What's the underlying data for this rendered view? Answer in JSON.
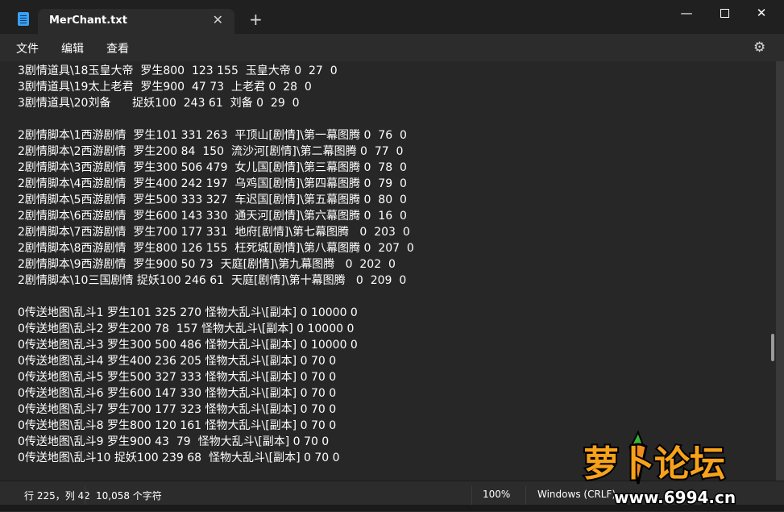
{
  "window": {
    "tab_title": "MerChant.txt",
    "tab_close": "✕",
    "new_tab": "+",
    "minimize": "—",
    "close": "✕"
  },
  "menu": {
    "file": "文件",
    "edit": "编辑",
    "view": "查看"
  },
  "lines": [
    "3剧情道具\\18玉皇大帝  罗生800  123 155  玉皇大帝 0  27  0",
    "3剧情道具\\19太上老君  罗生900  47 73  上老君 0  28  0",
    "3剧情道具\\20刘备      捉妖100  243 61  刘备 0  29  0",
    "",
    "2剧情脚本\\1西游剧情  罗生101 331 263  平顶山[剧情]\\第一幕图腾 0  76  0",
    "2剧情脚本\\2西游剧情  罗生200 84  150  流沙河[剧情]\\第二幕图腾 0  77  0",
    "2剧情脚本\\3西游剧情  罗生300 506 479  女儿国[剧情]\\第三幕图腾 0  78  0",
    "2剧情脚本\\4西游剧情  罗生400 242 197  乌鸡国[剧情]\\第四幕图腾 0  79  0",
    "2剧情脚本\\5西游剧情  罗生500 333 327  车迟国[剧情]\\第五幕图腾 0  80  0",
    "2剧情脚本\\6西游剧情  罗生600 143 330  通天河[剧情]\\第六幕图腾 0  16  0",
    "2剧情脚本\\7西游剧情  罗生700 177 331  地府[剧情]\\第七幕图腾   0  203  0",
    "2剧情脚本\\8西游剧情  罗生800 126 155  枉死城[剧情]\\第八幕图腾 0  207  0",
    "2剧情脚本\\9西游剧情  罗生900 50 73  天庭[剧情]\\第九幕图腾   0  202  0",
    "2剧情脚本\\10三国剧情 捉妖100 246 61  天庭[剧情]\\第十幕图腾   0  209  0",
    "",
    "0传送地图\\乱斗1 罗生101 325 270 怪物大乱斗\\[副本] 0 10000 0",
    "0传送地图\\乱斗2 罗生200 78  157 怪物大乱斗\\[副本] 0 10000 0",
    "0传送地图\\乱斗3 罗生300 500 486 怪物大乱斗\\[副本] 0 10000 0",
    "0传送地图\\乱斗4 罗生400 236 205 怪物大乱斗\\[副本] 0 70 0",
    "0传送地图\\乱斗5 罗生500 327 333 怪物大乱斗\\[副本] 0 70 0",
    "0传送地图\\乱斗6 罗生600 147 330 怪物大乱斗\\[副本] 0 70 0",
    "0传送地图\\乱斗7 罗生700 177 323 怪物大乱斗\\[副本] 0 70 0",
    "0传送地图\\乱斗8 罗生800 120 161 怪物大乱斗\\[副本] 0 70 0",
    "0传送地图\\乱斗9 罗生900 43  79  怪物大乱斗\\[副本] 0 70 0",
    "0传送地图\\乱斗10 捉妖100 239 68  怪物大乱斗\\[副本] 0 70 0"
  ],
  "status": {
    "position": "行 225，列 42",
    "chars": "10,058 个字符",
    "zoom": "100%",
    "encoding": "Windows (CRLF)"
  },
  "watermark": {
    "brand": "萝卜论坛",
    "url": "www.6994.cn"
  }
}
